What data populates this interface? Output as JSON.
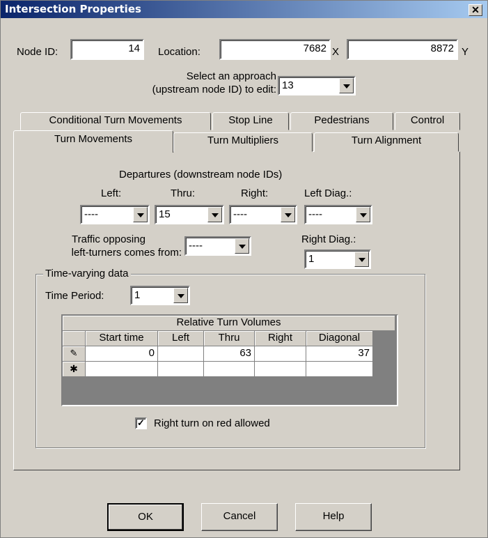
{
  "window": {
    "title": "Intersection Properties",
    "close_glyph": "✕"
  },
  "header": {
    "node_id_label": "Node ID:",
    "node_id": "14",
    "location_label": "Location:",
    "location_x": "7682",
    "x_label": "X",
    "location_y": "8872",
    "y_label": "Y",
    "approach_label_line1": "Select an approach",
    "approach_label_line2": "(upstream node ID) to edit:",
    "approach_value": "13"
  },
  "tabs": {
    "back_row": [
      "Conditional Turn Movements",
      "Stop Line",
      "Pedestrians",
      "Control"
    ],
    "front_row": [
      "Turn Movements",
      "Turn Multipliers",
      "Turn Alignment"
    ],
    "active": "Turn Movements"
  },
  "turn_movements": {
    "departures_label": "Departures (downstream node IDs)",
    "left_label": "Left:",
    "thru_label": "Thru:",
    "right_label": "Right:",
    "left_diag_label": "Left Diag.:",
    "left_value": "----",
    "thru_value": "15",
    "right_value": "----",
    "left_diag_value": "----",
    "opposing_label_line1": "Traffic opposing",
    "opposing_label_line2": "left-turners comes from:",
    "opposing_value": "----",
    "right_diag_label": "Right Diag.:",
    "right_diag_value": "1",
    "time_varying": {
      "group_label": "Time-varying data",
      "period_label": "Time Period:",
      "period_value": "1",
      "grid": {
        "title": "Relative Turn Volumes",
        "columns": [
          "Start time",
          "Left",
          "Thru",
          "Right",
          "Diagonal"
        ],
        "rows": [
          {
            "indicator": "✎",
            "cells": [
              "0",
              "",
              "63",
              "",
              "37"
            ]
          },
          {
            "indicator": "✱",
            "cells": [
              "",
              "",
              "",
              "",
              ""
            ]
          }
        ]
      },
      "right_turn_on_red_label": "Right turn on red allowed",
      "right_turn_on_red_checked": true,
      "check_glyph": "✓"
    }
  },
  "buttons": {
    "ok": "OK",
    "cancel": "Cancel",
    "help": "Help"
  }
}
